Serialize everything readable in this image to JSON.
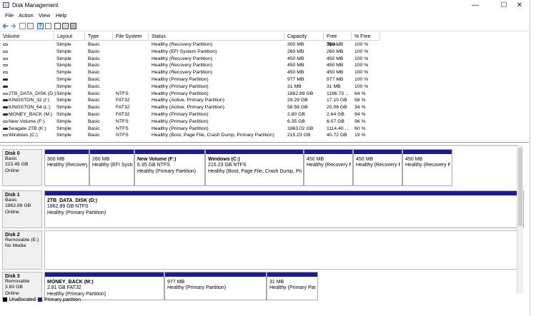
{
  "window": {
    "title": "Disk Management"
  },
  "menu": [
    "File",
    "Action",
    "View",
    "Help"
  ],
  "columns": [
    "Volume",
    "Layout",
    "Type",
    "File System",
    "Status",
    "Capacity",
    "Free Spa...",
    "% Free"
  ],
  "volumes": [
    {
      "volume": "",
      "layout": "Simple",
      "type": "Basic",
      "fs": "",
      "status": "Healthy (Recovery Partition)",
      "capacity": "300 MB",
      "free": "300 MB",
      "pct": "100 %",
      "icon": "light"
    },
    {
      "volume": "",
      "layout": "Simple",
      "type": "Basic",
      "fs": "",
      "status": "Healthy (EFI System Partition)",
      "capacity": "260 MB",
      "free": "260 MB",
      "pct": "100 %",
      "icon": "light"
    },
    {
      "volume": "",
      "layout": "Simple",
      "type": "Basic",
      "fs": "",
      "status": "Healthy (Recovery Partition)",
      "capacity": "450 MB",
      "free": "450 MB",
      "pct": "100 %",
      "icon": "light"
    },
    {
      "volume": "",
      "layout": "Simple",
      "type": "Basic",
      "fs": "",
      "status": "Healthy (Recovery Partition)",
      "capacity": "450 MB",
      "free": "450 MB",
      "pct": "100 %",
      "icon": "light"
    },
    {
      "volume": "",
      "layout": "Simple",
      "type": "Basic",
      "fs": "",
      "status": "Healthy (Recovery Partition)",
      "capacity": "450 MB",
      "free": "450 MB",
      "pct": "100 %",
      "icon": "light"
    },
    {
      "volume": "",
      "layout": "Simple",
      "type": "Basic",
      "fs": "",
      "status": "Healthy (Primary Partition)",
      "capacity": "977 MB",
      "free": "977 MB",
      "pct": "100 %",
      "icon": "dark"
    },
    {
      "volume": "",
      "layout": "Simple",
      "type": "Basic",
      "fs": "",
      "status": "Healthy (Primary Partition)",
      "capacity": "31 MB",
      "free": "31 MB",
      "pct": "100 %",
      "icon": "dark"
    },
    {
      "volume": "2TB_DATA_DISK (D:)",
      "layout": "Simple",
      "type": "Basic",
      "fs": "NTFS",
      "status": "Healthy (Primary Partition)",
      "capacity": "1862.89 GB",
      "free": "1196.73 ...",
      "pct": "64 %",
      "icon": "light"
    },
    {
      "volume": "KINGSTON_32 (I:)",
      "layout": "Simple",
      "type": "Basic",
      "fs": "FAT32",
      "status": "Healthy (Active, Primary Partition)",
      "capacity": "29.29 GB",
      "free": "17.10 GB",
      "pct": "58 %",
      "icon": "dark"
    },
    {
      "volume": "KINGSTON_64 (L:)",
      "layout": "Simple",
      "type": "Basic",
      "fs": "FAT32",
      "status": "Healthy (Active, Primary Partition)",
      "capacity": "58.58 GB",
      "free": "20.06 GB",
      "pct": "34 %",
      "icon": "dark"
    },
    {
      "volume": "MONEY_BACK (M:)",
      "layout": "Simple",
      "type": "Basic",
      "fs": "FAT32",
      "status": "Healthy (Primary Partition)",
      "capacity": "2.80 GB",
      "free": "2.64 GB",
      "pct": "94 %",
      "icon": "dark"
    },
    {
      "volume": "New Volume (F:)",
      "layout": "Simple",
      "type": "Basic",
      "fs": "NTFS",
      "status": "Healthy (Primary Partition)",
      "capacity": "6.35 GB",
      "free": "6.07 GB",
      "pct": "96 %",
      "icon": "light"
    },
    {
      "volume": "Seagate 2TB (K:)",
      "layout": "Simple",
      "type": "Basic",
      "fs": "NTFS",
      "status": "Healthy (Primary Partition)",
      "capacity": "1863.02 GB",
      "free": "1114.40 ...",
      "pct": "60 %",
      "icon": "dark"
    },
    {
      "volume": "Windows (C:)",
      "layout": "Simple",
      "type": "Basic",
      "fs": "NTFS",
      "status": "Healthy (Boot, Page File, Crash Dump, Primary Partition)",
      "capacity": "215.23 GB",
      "free": "40.72 GB",
      "pct": "19 %",
      "icon": "light"
    }
  ],
  "disks": [
    {
      "name": "Disk 0",
      "kind": "Basic",
      "size": "223.45 GB",
      "state": "Online",
      "partitions": [
        {
          "name": "",
          "detail": "300 MB",
          "status": "Healthy (Recovery"
        },
        {
          "name": "",
          "detail": "260 MB",
          "status": "Healthy (EFI Syste"
        },
        {
          "name": "New Volume  (F:)",
          "detail": "6.35 GB NTFS",
          "status": "Healthy (Primary Partition)"
        },
        {
          "name": "Windows  (C:)",
          "detail": "215.23 GB NTFS",
          "status": "Healthy (Boot, Page File, Crash Dump, Prin"
        },
        {
          "name": "",
          "detail": "450 MB",
          "status": "Healthy (Recovery P"
        },
        {
          "name": "",
          "detail": "450 MB",
          "status": "Healthy (Recovery P"
        },
        {
          "name": "",
          "detail": "450 MB",
          "status": "Healthy (Recovery P"
        }
      ]
    },
    {
      "name": "Disk 1",
      "kind": "Basic",
      "size": "1862.89 GB",
      "state": "Online",
      "partitions": [
        {
          "name": "2TB_DATA_DISK  (D:)",
          "detail": "1862.89 GB NTFS",
          "status": "Healthy (Primary Partition)"
        }
      ]
    },
    {
      "name": "Disk 2",
      "kind": "Removable (E:)",
      "size": "",
      "state": "No Media",
      "partitions": []
    },
    {
      "name": "Disk 3",
      "kind": "Removable",
      "size": "3.80 GB",
      "state": "Online",
      "partitions": [
        {
          "name": "MONEY_BACK  (M:)",
          "detail": "2.81 GB FAT32",
          "status": "Healthy (Primary Partition)"
        },
        {
          "name": "",
          "detail": "977 MB",
          "status": "Healthy (Primary Partition)"
        },
        {
          "name": "",
          "detail": "31 MB",
          "status": "Healthy (Primary Par"
        }
      ]
    }
  ],
  "legend": [
    {
      "label": "Unallocated",
      "color": "#000000"
    },
    {
      "label": "Primary partition",
      "color": "#1c1c8a"
    }
  ],
  "window_controls": {
    "minimize": "—",
    "maximize": "☐",
    "close": "✕"
  }
}
